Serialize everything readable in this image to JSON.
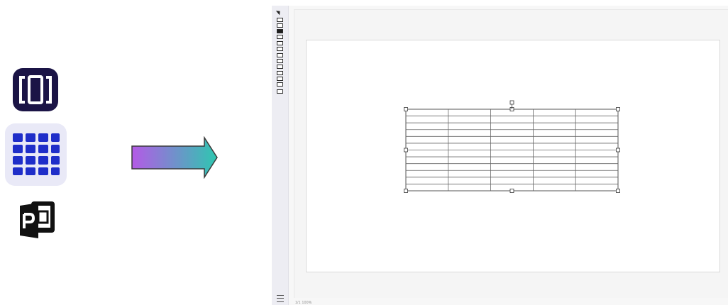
{
  "left_icons": [
    {
      "name": "carousel-app-icon",
      "color": "#1b1446"
    },
    {
      "name": "grid-app-icon",
      "color": "#1f2ec9"
    },
    {
      "name": "publisher-app-icon",
      "color": "#111111"
    }
  ],
  "arrow": {
    "gradient_start": "#b45ae6",
    "gradient_end": "#2ec7b0"
  },
  "toolbar": {
    "tools": [
      "pointer-tool",
      "image-tool",
      "text-tool",
      "shape-tool",
      "object-tool",
      "video-tool",
      "audio-tool",
      "chart-tool",
      "image-tool-2",
      "graph-tool",
      "video-tool-2",
      "embed-tool",
      "table-tool",
      "more-tool"
    ],
    "settings": "settings-icon"
  },
  "slide": {
    "table": {
      "columns": 5,
      "rows": 12
    }
  },
  "status": {
    "text": "1/1 100%"
  }
}
